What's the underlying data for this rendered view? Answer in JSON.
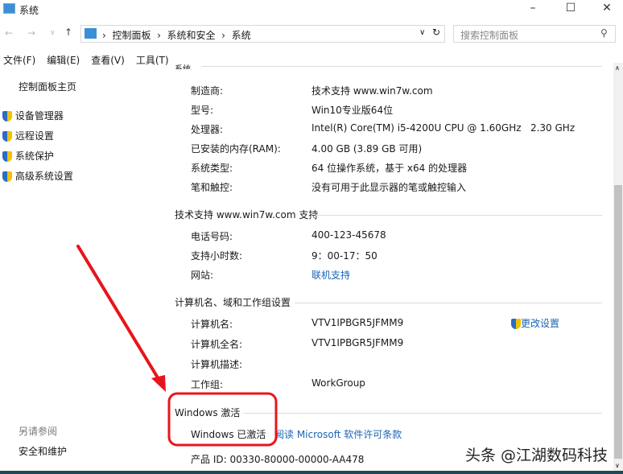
{
  "window": {
    "title": "系统",
    "minimize": "–",
    "maximize": "☐",
    "close": "✕"
  },
  "address": {
    "breadcrumb": [
      "控制面板",
      "系统和安全",
      "系统"
    ],
    "search_placeholder": "搜索控制面板"
  },
  "menu": [
    "文件(F)",
    "编辑(E)",
    "查看(V)",
    "工具(T)"
  ],
  "sidebar": {
    "home": "控制面板主页",
    "items": [
      "设备管理器",
      "远程设置",
      "系统保护",
      "高级系统设置"
    ],
    "see_also": "另请参阅",
    "see_also_items": [
      "安全和维护"
    ]
  },
  "sections": {
    "system": {
      "title": "系统",
      "rows": [
        [
          "制造商:",
          "技术支持 www.win7w.com"
        ],
        [
          "型号:",
          "Win10专业版64位"
        ],
        [
          "处理器:",
          "Intel(R) Core(TM) i5-4200U CPU @ 1.60GHz   2.30 GHz"
        ],
        [
          "已安装的内存(RAM):",
          "4.00 GB (3.89 GB 可用)"
        ],
        [
          "系统类型:",
          "64 位操作系统，基于 x64 的处理器"
        ],
        [
          "笔和触控:",
          "没有可用于此显示器的笔或触控输入"
        ]
      ]
    },
    "support": {
      "title": "技术支持 www.win7w.com 支持",
      "rows": [
        [
          "电话号码:",
          "400-123-45678"
        ],
        [
          "支持小时数:",
          "9：00-17：50"
        ],
        [
          "网站:",
          "联机支持"
        ]
      ]
    },
    "computer": {
      "title": "计算机名、域和工作组设置",
      "change": "更改设置",
      "rows": [
        [
          "计算机名:",
          "VTV1IPBGR5JFMM9"
        ],
        [
          "计算机全名:",
          "VTV1IPBGR5JFMM9"
        ],
        [
          "计算机描述:",
          ""
        ],
        [
          "工作组:",
          "WorkGroup"
        ]
      ]
    },
    "activation": {
      "title": "Windows 激活",
      "status": "Windows 已激活",
      "license_link": "阅读 Microsoft 软件许可条款",
      "product_id": "产品 ID: 00330-80000-00000-AA478"
    }
  },
  "watermark": "头条 @江湖数码科技",
  "annotation_color": "#e8141c"
}
